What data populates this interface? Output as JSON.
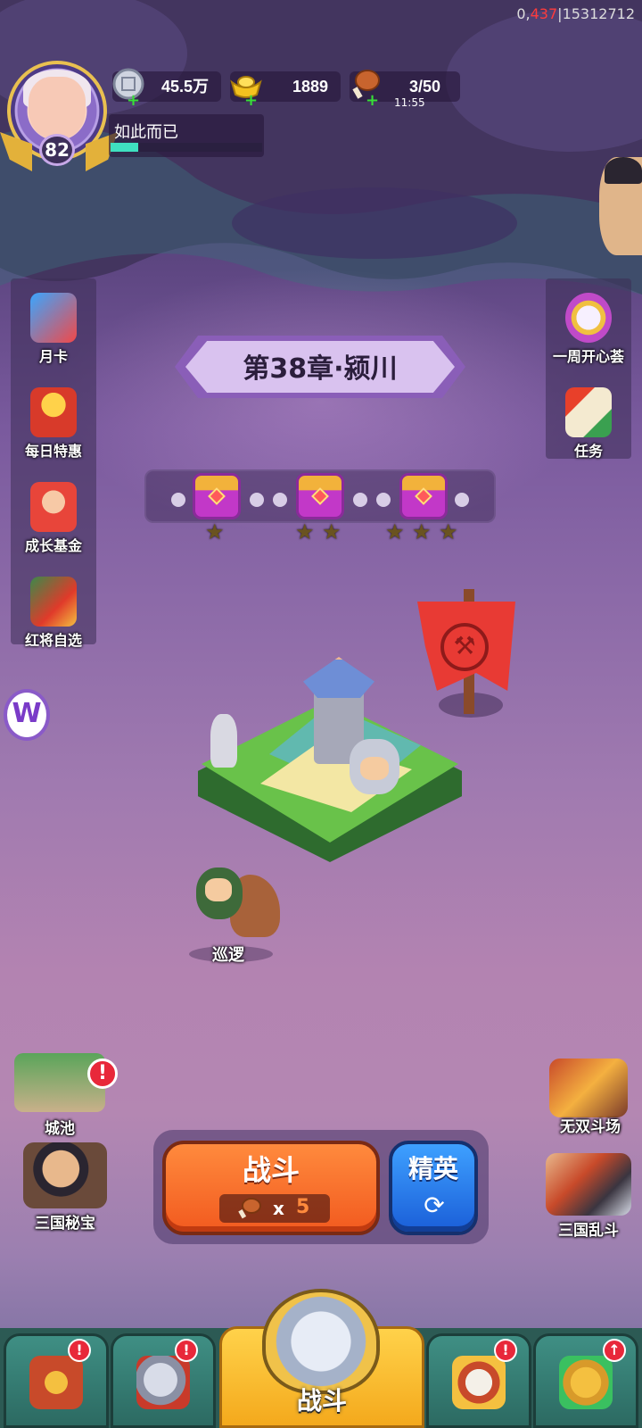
{
  "debug": {
    "prefix": "0,",
    "highlight": "437",
    "suffix": "|15312712"
  },
  "player": {
    "name": "如此而已",
    "level": "82",
    "exp_fraction": 0.18
  },
  "currencies": {
    "silver": "45.5万",
    "gold": "1889",
    "stamina": "3/50",
    "stamina_timer": "11:55"
  },
  "left_menu": [
    {
      "label": "月卡",
      "icon": "month-card-icon"
    },
    {
      "label": "每日特惠",
      "icon": "daily-deal-icon"
    },
    {
      "label": "成长基金",
      "icon": "growth-fund-icon"
    },
    {
      "label": "红将自选",
      "icon": "red-general-select-icon"
    }
  ],
  "right_menu": [
    {
      "label": "一周开心荟",
      "icon": "weekly-fun-icon"
    },
    {
      "label": "任务",
      "icon": "quest-scroll-icon"
    }
  ],
  "chapter": {
    "title": "第38章·颍川"
  },
  "progress": {
    "chests": [
      {
        "stars": 1
      },
      {
        "stars": 2
      },
      {
        "stars": 3
      }
    ]
  },
  "map": {
    "patrol_label": "巡逻"
  },
  "features_left": [
    {
      "label": "城池",
      "alert": "!"
    },
    {
      "label": "三国秘宝"
    }
  ],
  "features_right": [
    {
      "label": "无双斗场"
    },
    {
      "label": "三国乱斗"
    }
  ],
  "battle": {
    "fight_label": "战斗",
    "cost_x": "x",
    "cost_value": "5",
    "elite_label": "精英"
  },
  "bottom_nav": {
    "center_label": "战斗",
    "tabs": [
      {
        "icon": "gate-treasure-icon",
        "alert": "!"
      },
      {
        "icon": "helmet-icon",
        "alert": "!"
      },
      {
        "icon": "horn-stars-icon",
        "alert": "!"
      },
      {
        "icon": "fist-upgrade-icon",
        "alert": "↑"
      }
    ]
  },
  "colors": {
    "fight": "#f25a1f",
    "elite": "#1a5ed8",
    "nav_active": "#f4a91c",
    "alert": "#e8283a"
  }
}
